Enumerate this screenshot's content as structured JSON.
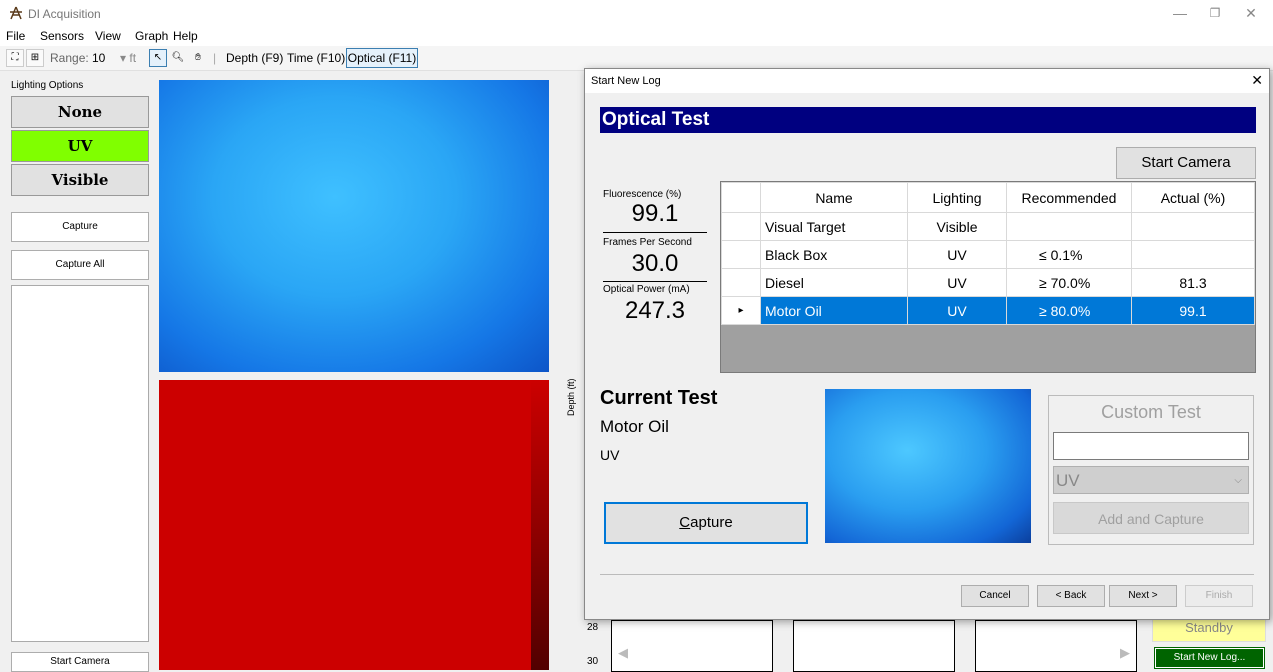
{
  "window": {
    "title": "DI Acquisition",
    "min": "—",
    "restore": "❐",
    "close": "✕"
  },
  "menu": [
    "File",
    "Sensors",
    "View",
    "Graph",
    "Help"
  ],
  "toolbar": {
    "range_label": "Range:",
    "range_value": "10",
    "range_unit": "▾ ft",
    "depth": "Depth (F9)",
    "time": "Time (F10)",
    "optical": "Optical (F11)"
  },
  "left": {
    "lighting_label": "Lighting Options",
    "none": "None",
    "uv": "UV",
    "visible": "Visible",
    "capture": "Capture",
    "capture_all": "Capture All",
    "start_camera": "Start Camera",
    "uv_color": "#80ff00"
  },
  "axis": {
    "depth_label": "Depth (ft)",
    "tick_28": "28",
    "tick_30": "30"
  },
  "dialog": {
    "title": "Start New Log",
    "close": "✕",
    "banner": "Optical Test",
    "start_camera": "Start Camera",
    "stats": {
      "fluor_label": "Fluorescence (%)",
      "fluor_value": "99.1",
      "fps_label": "Frames Per Second",
      "fps_value": "30.0",
      "power_label": "Optical Power (mA)",
      "power_value": "247.3"
    },
    "table": {
      "headers": [
        "Name",
        "Lighting",
        "Recommended",
        "Actual (%)"
      ],
      "rows": [
        {
          "marker": "",
          "name": "Visual Target",
          "lighting": "Visible",
          "recommended": "",
          "actual": ""
        },
        {
          "marker": "",
          "name": "Black Box",
          "lighting": "UV",
          "recommended": "≤ 0.1%",
          "actual": ""
        },
        {
          "marker": "",
          "name": "Diesel",
          "lighting": "UV",
          "recommended": "≥ 70.0%",
          "actual": "81.3"
        },
        {
          "marker": "▸",
          "name": "Motor Oil",
          "lighting": "UV",
          "recommended": "≥ 80.0%",
          "actual": "99.1"
        }
      ]
    },
    "current": {
      "title": "Current Test",
      "name": "Motor Oil",
      "lighting": "UV",
      "capture_C": "C",
      "capture_rest": "apture"
    },
    "custom": {
      "title": "Custom Test",
      "select_value": "UV",
      "chevron": "⌵",
      "add": "Add and Capture"
    },
    "buttons": {
      "cancel": "Cancel",
      "back": "< Back",
      "next": "Next >",
      "finish": "Finish"
    }
  },
  "status": {
    "standby": "Standby",
    "start_new_log": "Start New Log..."
  },
  "colors": {
    "banner": "#000080",
    "selection": "#0078d7",
    "standby": "#ffff99",
    "start_log": "#006400"
  }
}
